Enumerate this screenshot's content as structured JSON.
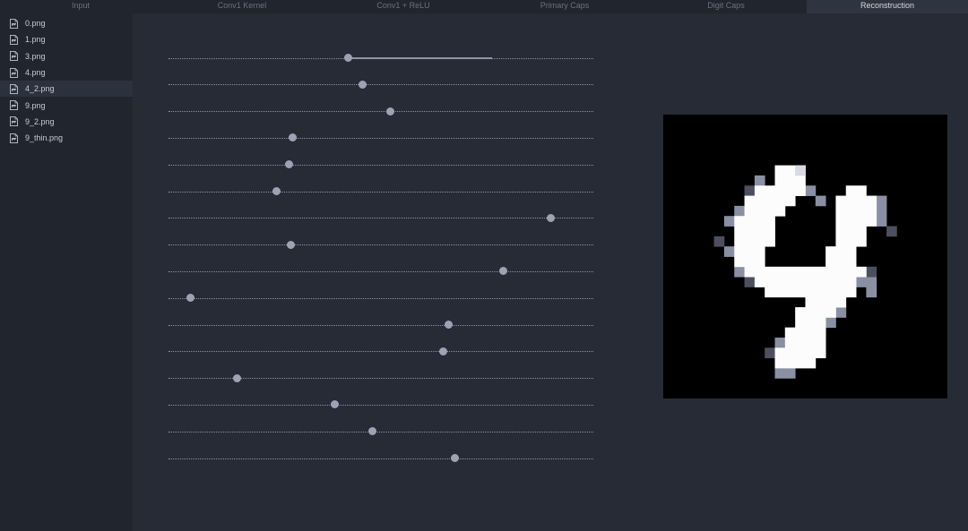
{
  "tabs": [
    {
      "label": "Input",
      "active": false
    },
    {
      "label": "Conv1 Kernel",
      "active": false
    },
    {
      "label": "Conv1 + ReLU",
      "active": false
    },
    {
      "label": "Primary Caps",
      "active": false
    },
    {
      "label": "Digit Caps",
      "active": false
    },
    {
      "label": "Reconstruction",
      "active": true
    }
  ],
  "files": [
    {
      "label": "0.png",
      "selected": false
    },
    {
      "label": "1.png",
      "selected": false
    },
    {
      "label": "3.png",
      "selected": false
    },
    {
      "label": "4.png",
      "selected": false
    },
    {
      "label": "4_2.png",
      "selected": true
    },
    {
      "label": "9.png",
      "selected": false
    },
    {
      "label": "9_2.png",
      "selected": false
    },
    {
      "label": "9_thin.png",
      "selected": false
    }
  ],
  "sliders": [
    {
      "value": 0.423,
      "hover_to": 0.762
    },
    {
      "value": 0.456
    },
    {
      "value": 0.522
    },
    {
      "value": 0.293
    },
    {
      "value": 0.283
    },
    {
      "value": 0.255
    },
    {
      "value": 0.899
    },
    {
      "value": 0.287
    },
    {
      "value": 0.787
    },
    {
      "value": 0.051
    },
    {
      "value": 0.659
    },
    {
      "value": 0.646
    },
    {
      "value": 0.161
    },
    {
      "value": 0.392
    },
    {
      "value": 0.479
    },
    {
      "value": 0.675
    }
  ],
  "reconstruction": {
    "digit_glyph": "4",
    "background_color": "#000000",
    "stroke_color": "#fcfcfc"
  }
}
